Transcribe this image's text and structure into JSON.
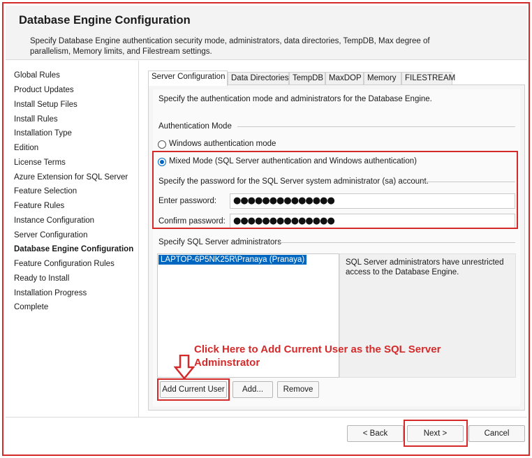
{
  "header": {
    "title": "Database Engine Configuration",
    "description": "Specify Database Engine authentication security mode, administrators, data directories, TempDB, Max degree of parallelism, Memory limits, and Filestream settings."
  },
  "nav": {
    "items": [
      {
        "label": "Global Rules"
      },
      {
        "label": "Product Updates"
      },
      {
        "label": "Install Setup Files"
      },
      {
        "label": "Install Rules"
      },
      {
        "label": "Installation Type"
      },
      {
        "label": "Edition"
      },
      {
        "label": "License Terms"
      },
      {
        "label": "Azure Extension for SQL Server"
      },
      {
        "label": "Feature Selection"
      },
      {
        "label": "Feature Rules"
      },
      {
        "label": "Instance Configuration"
      },
      {
        "label": "Server Configuration"
      },
      {
        "label": "Database Engine Configuration",
        "active": true
      },
      {
        "label": "Feature Configuration Rules"
      },
      {
        "label": "Ready to Install"
      },
      {
        "label": "Installation Progress"
      },
      {
        "label": "Complete"
      }
    ]
  },
  "tabs": [
    {
      "label": "Server Configuration",
      "active": true
    },
    {
      "label": "Data Directories"
    },
    {
      "label": "TempDB"
    },
    {
      "label": "MaxDOP"
    },
    {
      "label": "Memory"
    },
    {
      "label": "FILESTREAM"
    }
  ],
  "panel": {
    "intro": "Specify the authentication mode and administrators for the Database Engine.",
    "auth_mode_label": "Authentication Mode",
    "windows_auth_label": "Windows authentication mode",
    "mixed_mode_label": "Mixed Mode (SQL Server authentication and Windows authentication)",
    "selected_mode": "mixed",
    "sa_password_label": "Specify the password for the SQL Server system administrator (sa) account.",
    "enter_password_label": "Enter password:",
    "enter_password_value": "●●●●●●●●●●●●●●",
    "confirm_password_label": "Confirm password:",
    "confirm_password_value": "●●●●●●●●●●●●●●",
    "admins_label": "Specify SQL Server administrators",
    "admins": [
      "LAPTOP-6P5NK25R\\Pranaya (Pranaya)"
    ],
    "admins_description": "SQL Server administrators have unrestricted access to the Database Engine.",
    "add_current_user_label": "Add Current User",
    "add_label": "Add...",
    "remove_label": "Remove"
  },
  "annotation": {
    "callout_text": "Click Here to Add Current User as the SQL Server Adminstrator",
    "color": "#d42a2a"
  },
  "footer": {
    "back_label": "< Back",
    "next_label": "Next >",
    "cancel_label": "Cancel"
  },
  "colors": {
    "accent": "#0067c0",
    "highlight": "#d42a2a"
  }
}
